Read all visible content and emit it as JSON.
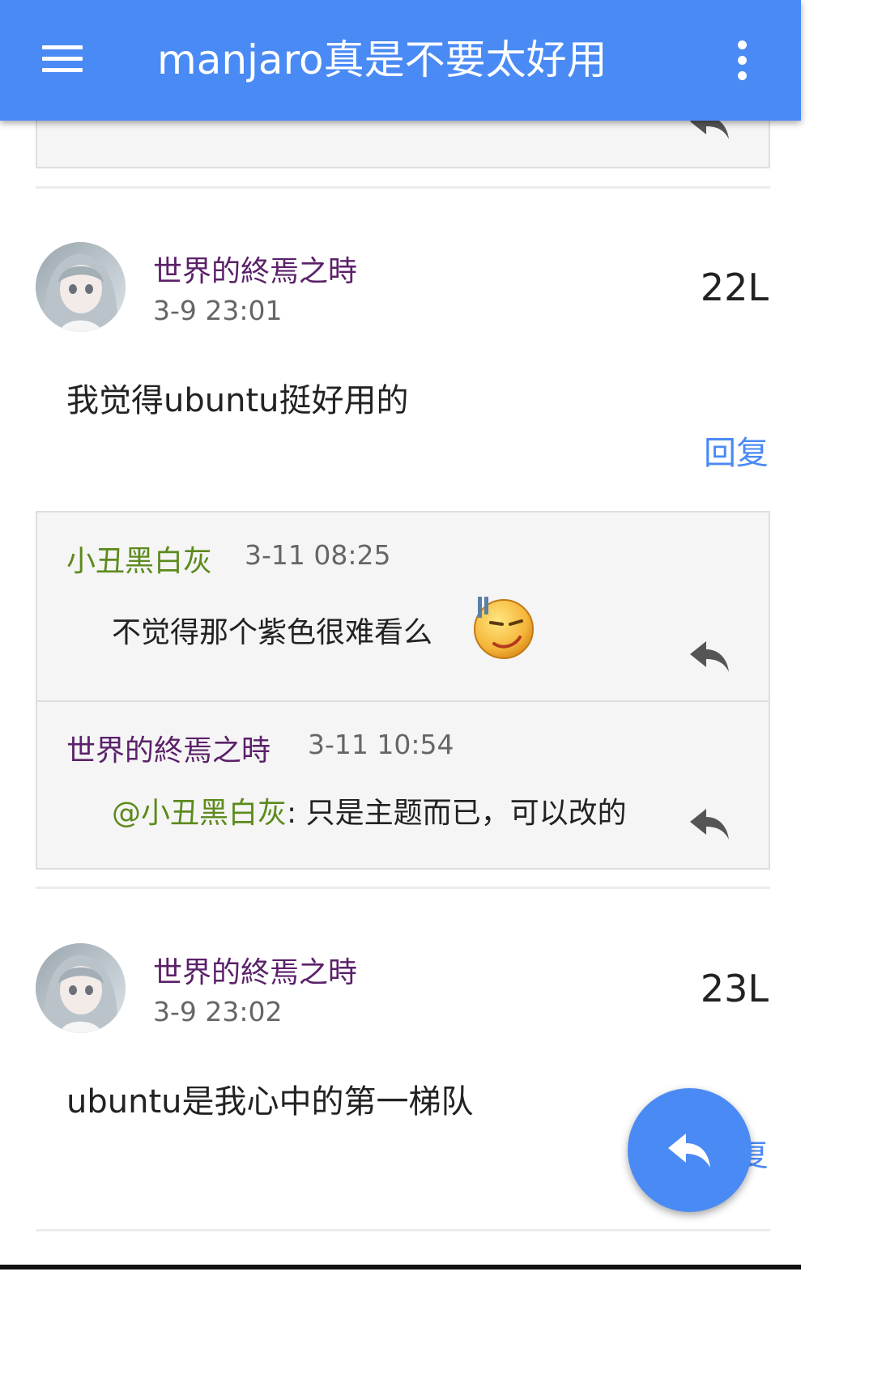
{
  "appbar": {
    "title": "manjaro真是不要太好用",
    "menu_icon": "menu-icon",
    "more_icon": "more-vert-icon",
    "background": "#4a8af4"
  },
  "posts": [
    {
      "author": "世界的終焉之時",
      "time": "3-9 23:01",
      "floor": "22L",
      "content": "我觉得ubuntu挺好用的",
      "reply_label": "回复",
      "quotes": [
        {
          "author": "小丑黑白灰",
          "time": "3-11 08:25",
          "text": "不觉得那个紫色很难看么",
          "emoji": "sweat-smile-emoji-icon"
        },
        {
          "author": "世界的終焉之時",
          "time": "3-11 10:54",
          "mention": "@小丑黑白灰",
          "text": ": 只是主题而已，可以改的"
        }
      ]
    },
    {
      "author": "世界的終焉之時",
      "time": "3-9 23:02",
      "floor": "23L",
      "content": "ubuntu是我心中的第一梯队",
      "reply_label": "回复"
    }
  ],
  "colors": {
    "accent": "#4a8af4",
    "author_purple": "#5b2169",
    "author_green": "#5c8a1c"
  }
}
